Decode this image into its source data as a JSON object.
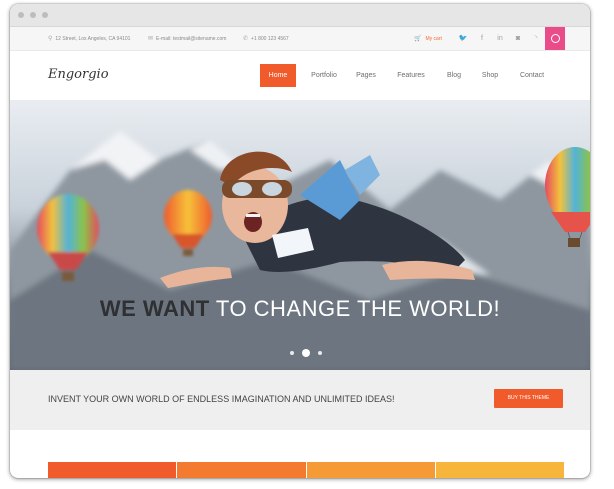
{
  "topbar": {
    "address": "12 Street, Los Angeles, CA 94101",
    "email": "E-mail: testmail@sitename.com",
    "phone": "+1 800 123 4567",
    "cart": "My cart",
    "socials": [
      "twitter-icon",
      "facebook-icon",
      "linkedin-icon",
      "instagram-icon",
      "rss-icon",
      "dribbble-icon"
    ]
  },
  "header": {
    "logo": "Engorgio",
    "nav": [
      "Home",
      "Portfolio",
      "Pages",
      "Features",
      "Blog",
      "Shop",
      "Contact"
    ],
    "active": "Home"
  },
  "hero": {
    "title_strong": "WE WANT",
    "title_rest": " TO CHANGE THE WORLD!",
    "slides": 3,
    "active_slide": 2
  },
  "cta": {
    "text": "INVENT YOUR OWN WORLD OF ENDLESS IMAGINATION AND UNLIMITED IDEAS!",
    "button": "BUY THIS THEME"
  },
  "colors": {
    "accent": "#f15a2b",
    "dribbble": "#ea4c89",
    "stripes": [
      "#f15a2b",
      "#f47a30",
      "#f69a35",
      "#f7b53b"
    ]
  }
}
